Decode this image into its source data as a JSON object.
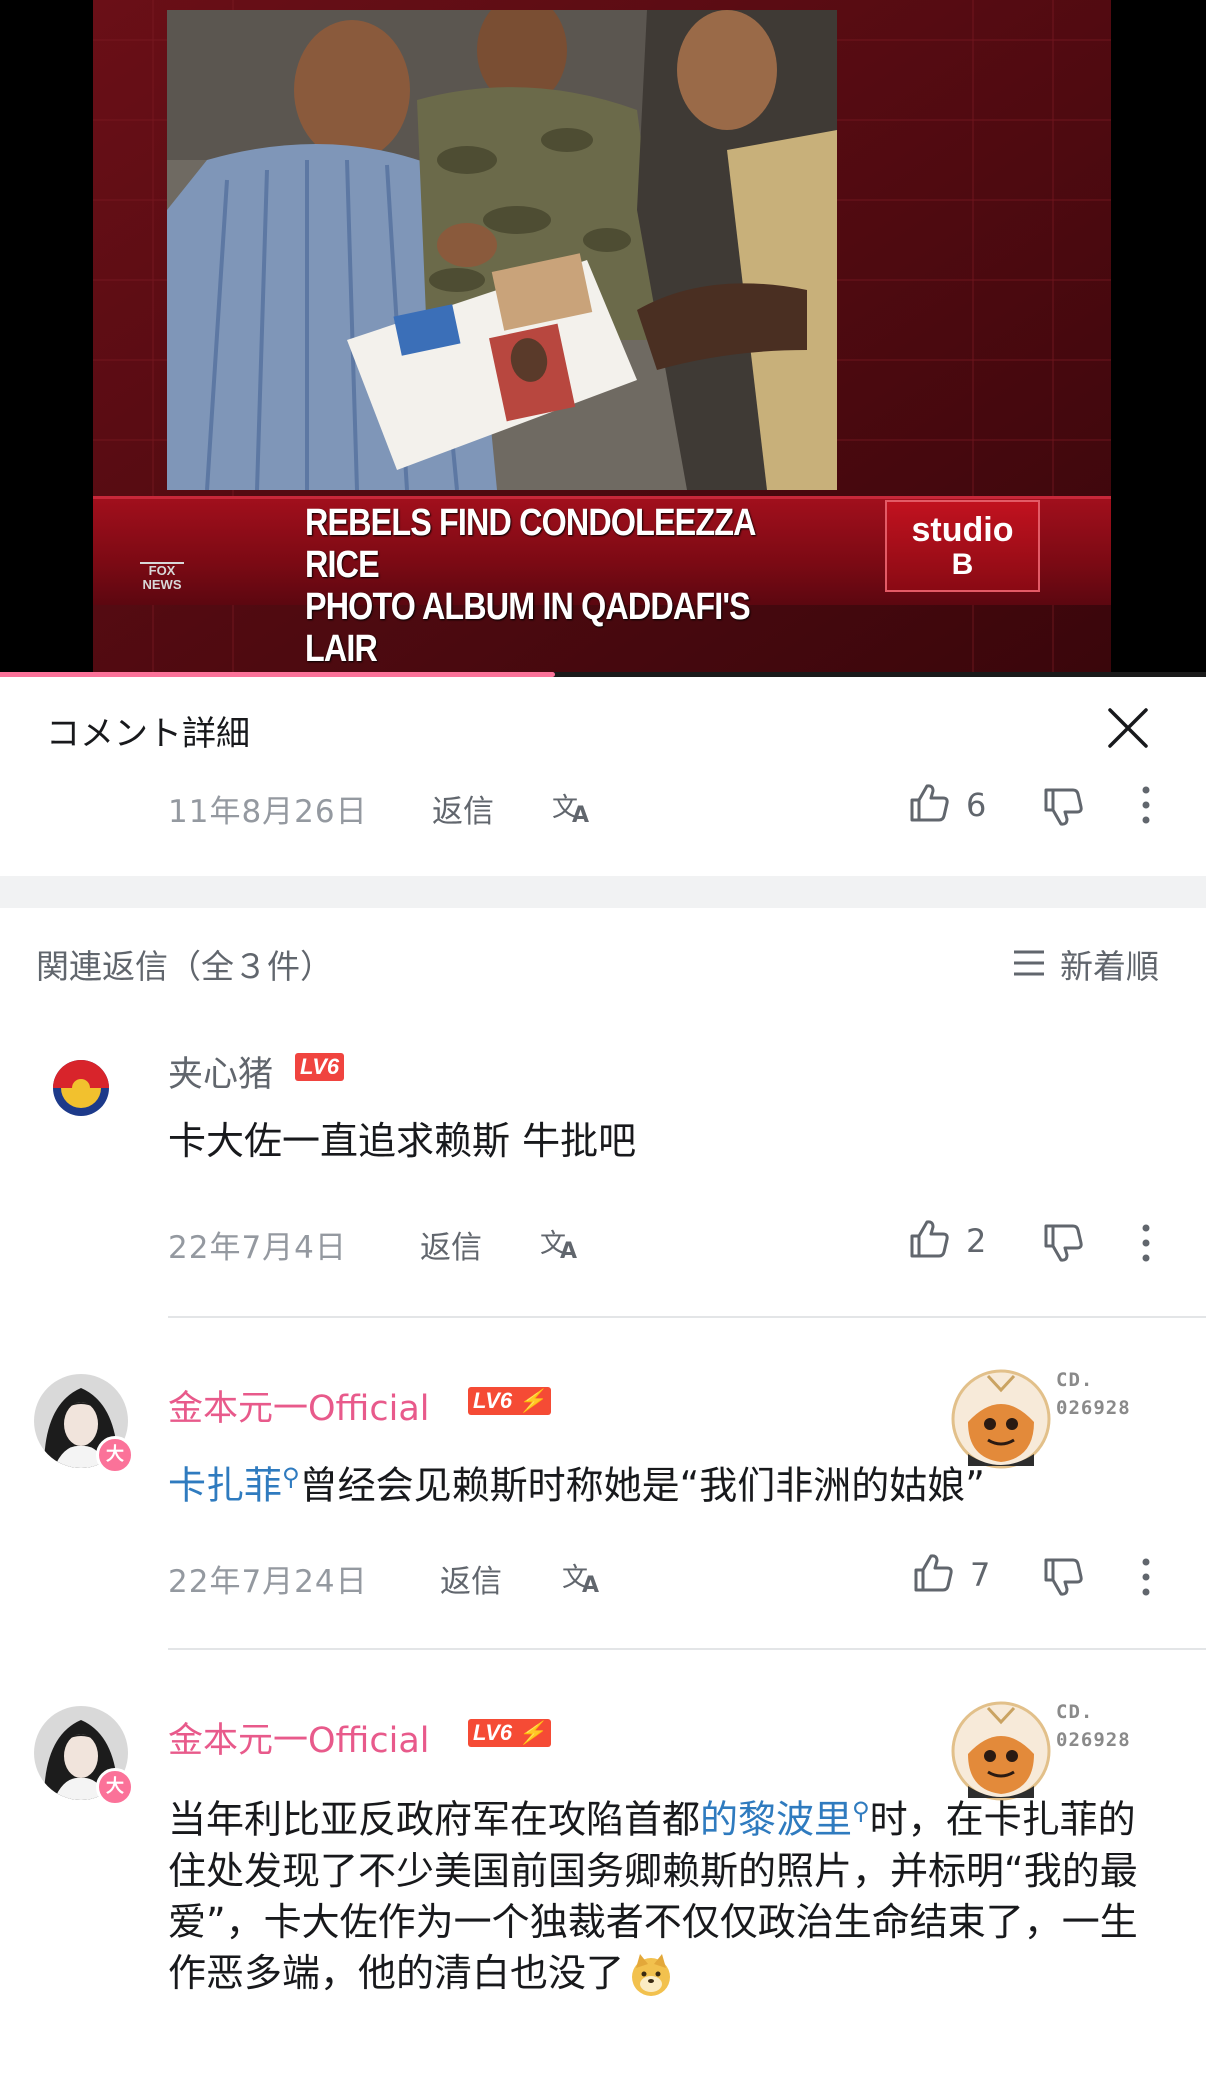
{
  "video": {
    "banner_line1": "REBELS FIND CONDOLEEZZA RICE",
    "banner_line2": "PHOTO ALBUM IN QADDAFI'S LAIR",
    "studio_word": "studio",
    "studio_letter": "B",
    "network_logo": "FOX NEWS",
    "progress_fraction": 0.46
  },
  "panel": {
    "title": "コメント詳細",
    "main_comment": {
      "date": "11年8月26日",
      "reply_label": "返信",
      "likes": "6"
    }
  },
  "replies_section": {
    "title": "関連返信（全３件）",
    "sort_label": "新着順"
  },
  "replies": [
    {
      "username": "夹心猪",
      "level": "LV6",
      "text": "卡大佐一直追求赖斯  牛批吧",
      "date": "22年7月4日",
      "reply_label": "返信",
      "likes": "2"
    },
    {
      "username": "金本元一Official",
      "level": "LV6",
      "fan_code_line1": "CD.",
      "fan_code_line2": "026928",
      "link_text": "卡扎菲",
      "text_after_link": "曾经会见赖斯时称她是“我们非洲的姑娘”",
      "date": "22年7月24日",
      "reply_label": "返信",
      "likes": "7"
    },
    {
      "username": "金本元一Official",
      "level": "LV6",
      "fan_code_line1": "CD.",
      "fan_code_line2": "026928",
      "text_before_link": "当年利比亚反政府军在攻陷首都",
      "link_text": "的黎波里",
      "text_after_link": "时，在卡扎菲的住处发现了不少美国前国务卿赖斯的照片，并标明“我的最爱”，卡大佐作为一个独裁者不仅仅政治生命结束了，一生作恶多端，他的清白也没了"
    }
  ],
  "vip_mark": "大",
  "colors": {
    "vip_name": "#e85a8b",
    "link": "#2f7bbf",
    "level_badge": "#f0443f",
    "progress": "#fb7299"
  }
}
